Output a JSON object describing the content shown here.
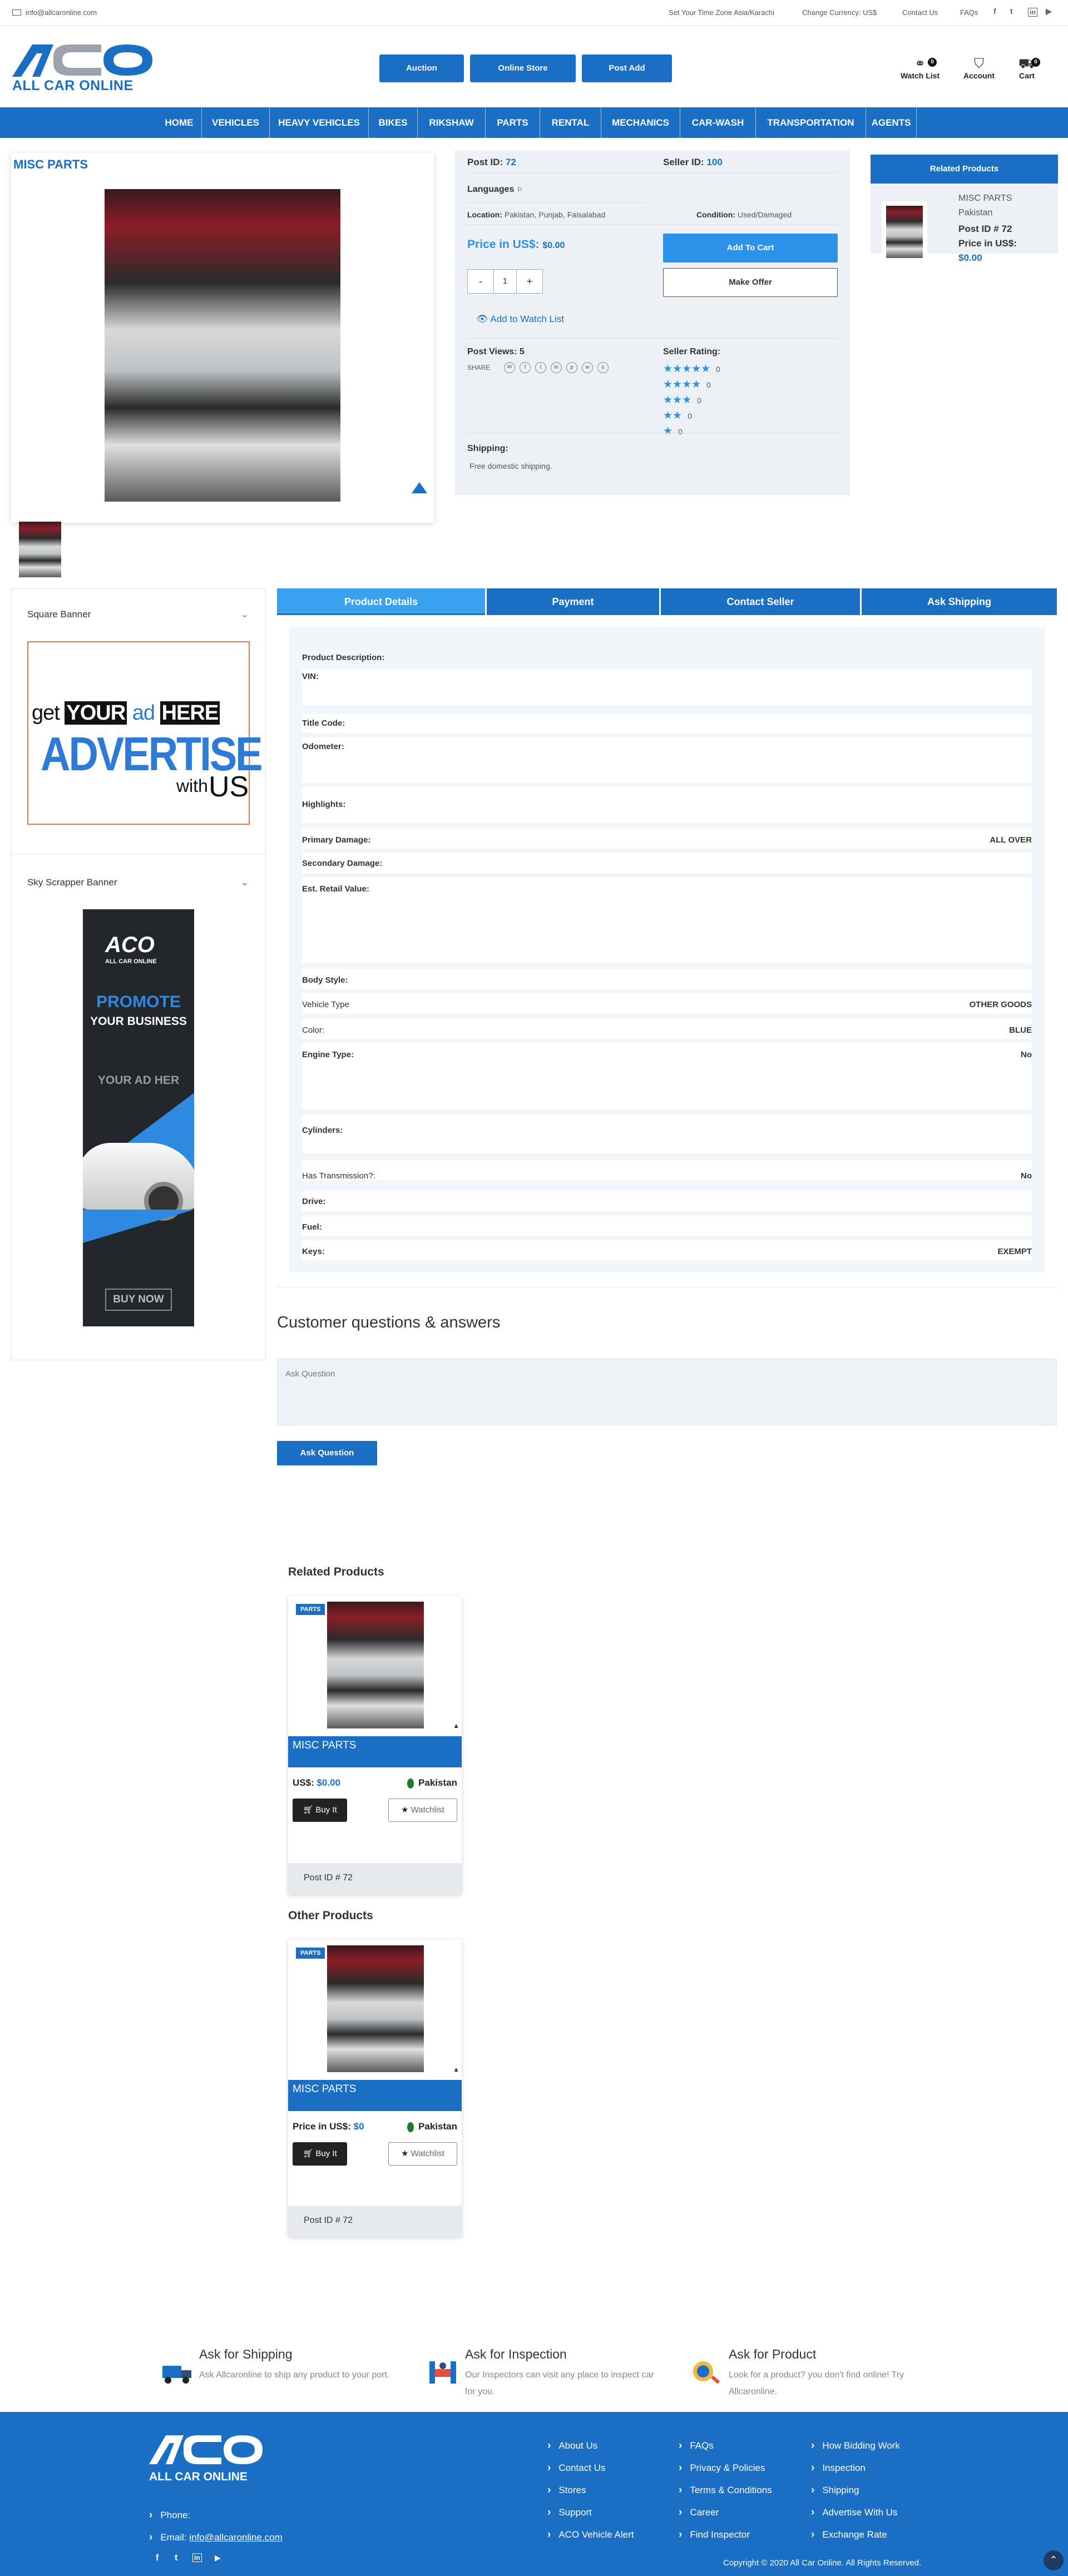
{
  "topbar": {
    "email": "info@allcaronline.com",
    "timezone": "Set Your Time Zone Asia/Karachi",
    "currency": "Change Currency: US$",
    "contact": "Contact Us",
    "faqs": "FAQs"
  },
  "brand": {
    "logo_text": "ACO",
    "logo_sub": "ALL CAR ONLINE",
    "accent": "#1a6fc4",
    "accent_light": "#2a92e8"
  },
  "header": {
    "buttons": [
      "Auction",
      "Online Store",
      "Post Add"
    ],
    "watch_label": "Watch List",
    "watch_count": "0",
    "account_label": "Account",
    "cart_label": "Cart",
    "cart_count": "0"
  },
  "nav": [
    "HOME",
    "VEHICLES",
    "HEAVY VEHICLES",
    "BIKES",
    "RIKSHAW",
    "PARTS",
    "RENTAL",
    "MECHANICS",
    "CAR-WASH",
    "TRANSPORTATION",
    "AGENTS"
  ],
  "product": {
    "title": "MISC PARTS",
    "post_id_label": "Post ID:",
    "post_id": "72",
    "seller_id_label": "Seller ID:",
    "seller_id": "100",
    "languages_label": "Languages",
    "location_label": "Location:",
    "location": "Pakistan, Punjab, Faisalabad",
    "condition_label": "Condition:",
    "condition": "Used/Damaged",
    "price_label": "Price in US$:",
    "price": "$0.00",
    "add_to_cart": "Add To Cart",
    "make_offer": "Make Offer",
    "qty_minus": "-",
    "qty_value": "1",
    "qty_plus": "+",
    "watch_link": "Add to Watch List",
    "views_label": "Post Views: 5",
    "share_label": "SHARE",
    "rating_label": "Seller Rating:",
    "ratings": [
      {
        "stars": "★★★★★",
        "count": "0"
      },
      {
        "stars": "★★★★",
        "count": "0"
      },
      {
        "stars": "★★★",
        "count": "0"
      },
      {
        "stars": "★★",
        "count": "0"
      },
      {
        "stars": "★",
        "count": "0"
      }
    ],
    "shipping_label": "Shipping:",
    "shipping_text": "Free domestic shipping."
  },
  "related_side": {
    "head": "Related Products",
    "name": "MISC PARTS",
    "country": "Pakistan",
    "post": "Post ID # 72",
    "price_label": "Price in US$:",
    "price": "$0.00"
  },
  "sidebar": {
    "square_banner": "Square Banner",
    "sky_banner": "Sky Scrapper Banner",
    "ad1": {
      "get": "get",
      "your": "YOUR",
      "ad": "ad",
      "here": "HERE",
      "advertise": "ADVERTISE",
      "with": "with",
      "us": "US"
    },
    "ad2": {
      "logo": "ACO",
      "logo_sub": "ALL CAR ONLINE",
      "promote": "PROMOTE",
      "business": "YOUR BUSINESS",
      "your_ad": "YOUR AD HER",
      "buy": "BUY NOW"
    }
  },
  "tabs": [
    "Product Details",
    "Payment",
    "Contact Seller",
    "Ask Shipping"
  ],
  "details": {
    "description": "Product Description:",
    "rows": [
      {
        "k": "VIN:",
        "v": ""
      },
      {
        "k": "Title Code:",
        "v": ""
      },
      {
        "k": "Odometer:",
        "v": ""
      },
      {
        "k": "Highlights:",
        "v": ""
      },
      {
        "k": "Primary Damage:",
        "v": "ALL OVER"
      },
      {
        "k": "Secondary Damage:",
        "v": ""
      },
      {
        "k": "Est. Retail Value:",
        "v": ""
      },
      {
        "k": "Body Style:",
        "v": ""
      },
      {
        "k": "Vehicle Type",
        "v": "OTHER GOODS"
      },
      {
        "k": "Color:",
        "v": "BLUE"
      },
      {
        "k": "Engine Type:",
        "v": "No"
      },
      {
        "k": "Cylinders:",
        "v": ""
      },
      {
        "k": "Has Transmission?:",
        "v": "No"
      },
      {
        "k": "Drive:",
        "v": ""
      },
      {
        "k": "Fuel:",
        "v": ""
      },
      {
        "k": "Keys:",
        "v": "EXEMPT"
      }
    ]
  },
  "qa": {
    "title": "Customer questions & answers",
    "placeholder": "Ask Question",
    "button": "Ask Question"
  },
  "related": {
    "heading": "Related Products",
    "tag": "PARTS",
    "name": "MISC PARTS",
    "price_label": "US$:",
    "price": "$0.00",
    "country": "Pakistan",
    "buy": "Buy It",
    "watch": "Watchlist",
    "post": "Post ID # 72"
  },
  "other": {
    "heading": "Other Products",
    "tag": "PARTS",
    "name": "MISC PARTS",
    "price_label": "Price in US$:",
    "price": "$0",
    "country": "Pakistan",
    "buy": "Buy It",
    "watch": "Watchlist",
    "post": "Post ID # 72"
  },
  "services": [
    {
      "title": "Ask for Shipping",
      "desc": "Ask Allcaronline to ship any product to your port."
    },
    {
      "title": "Ask for Inspection",
      "desc": "Our Inspectors can visit any place to inspect car for you."
    },
    {
      "title": "Ask for Product",
      "desc": "Look for a product? you don't find online! Try Allcaronline."
    }
  ],
  "footer": {
    "phone_label": "Phone:",
    "email_label": "Email:",
    "email": "info@allcaronline.com",
    "col1": [
      "About Us",
      "Contact Us",
      "Stores",
      "Support",
      "ACO Vehicle Alert"
    ],
    "col2": [
      "FAQs",
      "Privacy & Policies",
      "Terms & Conditions",
      "Career",
      "Find Inspector"
    ],
    "col3": [
      "How Bidding Work",
      "Inspection",
      "Shipping",
      "Advertise With Us",
      "Exchange Rate"
    ],
    "copyright": "Copyright © 2020 All Car Online. All Rights Reserved."
  }
}
